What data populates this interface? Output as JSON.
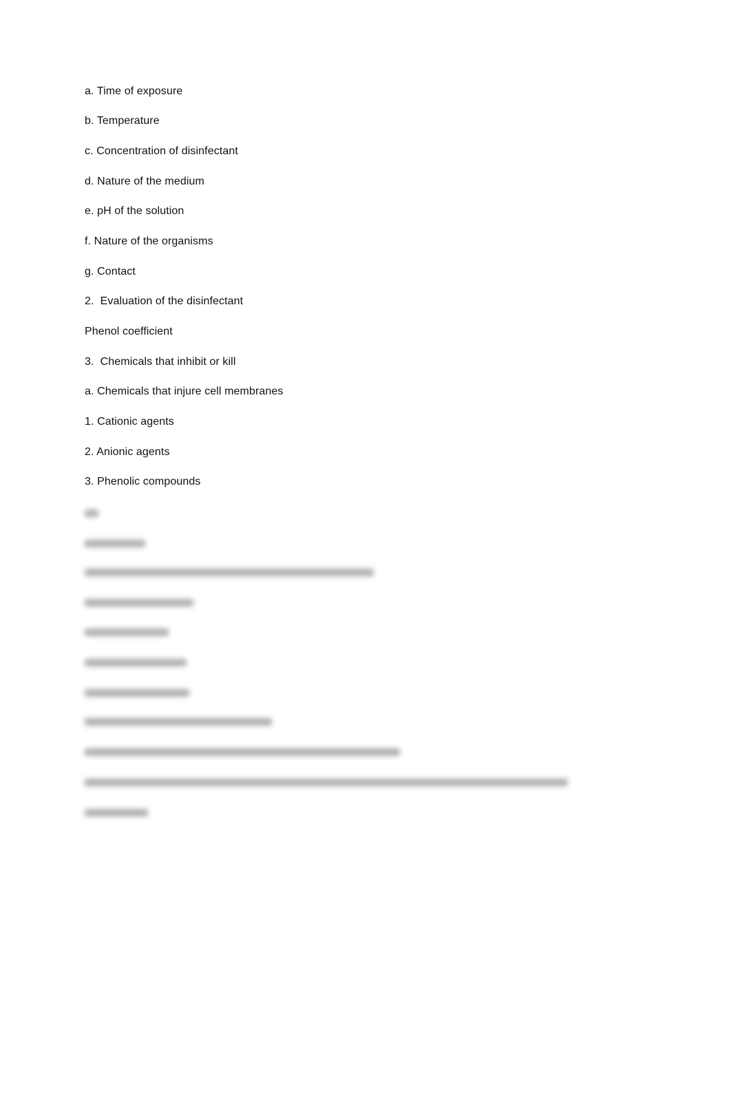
{
  "document": {
    "visible_lines": [
      "a. Time of exposure",
      "b. Temperature",
      "c. Concentration of disinfectant",
      "d. Nature of the medium",
      "e. pH of the solution",
      "f. Nature of the organisms",
      "g. Contact",
      "2.  Evaluation of the disinfectant",
      "Phenol coefficient",
      "3.  Chemicals that inhibit or kill",
      "a. Chemicals that injure cell membranes",
      "1. Cationic agents",
      "2. Anionic agents",
      "3. Phenolic compounds"
    ],
    "blurred_section_note": "Remaining content is blurred and illegible"
  }
}
